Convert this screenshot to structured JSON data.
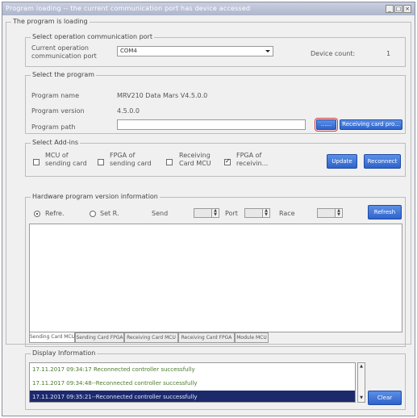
{
  "window": {
    "title": "Program loading -- the current communication port has device accessed",
    "minimize": "_",
    "maximize": "□",
    "close": "×"
  },
  "loading_group": {
    "legend": "The program is loading"
  },
  "comm_port": {
    "legend": "Select operation communication port",
    "label_line1": "Current operation",
    "label_line2": "communication port",
    "value": "COM4",
    "device_count_label": "Device count:",
    "device_count_value": "1"
  },
  "program": {
    "legend": "Select the program",
    "name_label": "Program name",
    "name_value": "MRV210 Data Mars V4.5.0.0",
    "version_label": "Program version",
    "version_value": "4.5.0.0",
    "path_label": "Program path",
    "path_value": "",
    "browse_button": "......",
    "receiving_card_button": "Receiving card pro..."
  },
  "addins": {
    "legend": "Select Add-ins",
    "items": [
      {
        "line1": "MCU of",
        "line2": "sending card",
        "checked": false
      },
      {
        "line1": "FPGA of",
        "line2": "sending card",
        "checked": false
      },
      {
        "line1": "Receiving",
        "line2": "Card MCU",
        "checked": false
      },
      {
        "line1": "FPGA of",
        "line2": "receivin...",
        "checked": true
      }
    ],
    "update_button": "Update",
    "reconnect_button": "Reconnect"
  },
  "hardware": {
    "legend": "Hardware program version information",
    "radio_refre": "Refre.",
    "radio_set": "Set R.",
    "send_label": "Send",
    "port_label": "Port",
    "race_label": "Race",
    "refresh_button": "Refresh",
    "tabs": [
      "Sending Card MCU",
      "Sending Card FPGA",
      "Receiving Card MCU",
      "Receiving Card FPGA",
      "Module MCU"
    ]
  },
  "display": {
    "legend": "Display Information",
    "lines": [
      "17.11.2017 09:34:17   Reconnected controller successfully",
      "17.11.2017 09:34:48--Reconnected controller successfully",
      "17.11.2017 09:35:21--Reconnected controller successfully"
    ],
    "clear_button": "Clear"
  },
  "colors": {
    "accent_button": "#2e63cc",
    "selection": "#1c2a6c",
    "log_text": "#4a7a2a"
  }
}
